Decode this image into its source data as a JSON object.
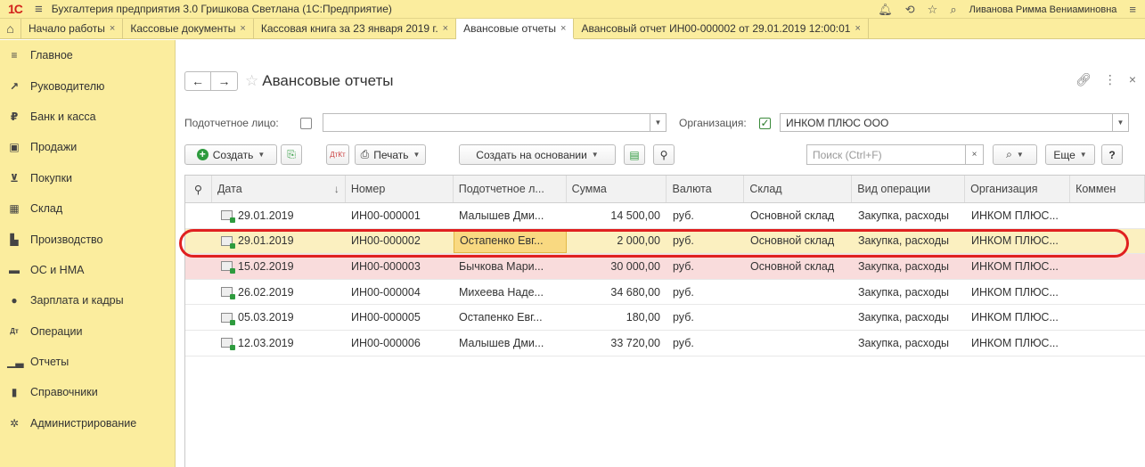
{
  "app": {
    "logo": "1С",
    "title": "Бухгалтерия предприятия 3.0 Гришкова Светлана  (1С:Предприятие)",
    "user": "Ливанова Римма Вениаминовна"
  },
  "tabs": [
    {
      "label": "Начало работы"
    },
    {
      "label": "Кассовые документы"
    },
    {
      "label": "Кассовая книга за 23 января 2019 г."
    },
    {
      "label": "Авансовые отчеты",
      "active": true
    },
    {
      "label": "Авансовый отчет ИН00-000002 от 29.01.2019 12:00:01"
    }
  ],
  "sidebar": {
    "items": [
      {
        "label": "Главное",
        "icon": "menu-icon"
      },
      {
        "label": "Руководителю",
        "icon": "trend-icon"
      },
      {
        "label": "Банк и касса",
        "icon": "coin-icon"
      },
      {
        "label": "Продажи",
        "icon": "bag-icon"
      },
      {
        "label": "Покупки",
        "icon": "cart-icon"
      },
      {
        "label": "Склад",
        "icon": "warehouse-icon"
      },
      {
        "label": "Производство",
        "icon": "factory-icon"
      },
      {
        "label": "ОС и НМА",
        "icon": "truck-icon"
      },
      {
        "label": "Зарплата и кадры",
        "icon": "person-icon"
      },
      {
        "label": "Операции",
        "icon": "dt-kt-icon"
      },
      {
        "label": "Отчеты",
        "icon": "bar-chart-icon"
      },
      {
        "label": "Справочники",
        "icon": "book-icon"
      },
      {
        "label": "Администрирование",
        "icon": "gear-icon"
      }
    ]
  },
  "page": {
    "title": "Авансовые отчеты"
  },
  "filters": {
    "person_label": "Подотчетное лицо:",
    "person_value": "",
    "org_label": "Организация:",
    "org_value": "ИНКОМ ПЛЮС ООО"
  },
  "toolbar": {
    "create": "Создать",
    "print": "Печать",
    "create_based": "Создать на основании",
    "search_placeholder": "Поиск (Ctrl+F)",
    "more": "Еще",
    "help": "?"
  },
  "table": {
    "columns": [
      "Дата",
      "Номер",
      "Подотчетное л...",
      "Сумма",
      "Валюта",
      "Склад",
      "Вид операции",
      "Организация",
      "Коммен"
    ],
    "rows": [
      {
        "date": "29.01.2019",
        "number": "ИН00-000001",
        "person": "Малышев Дми...",
        "sum": "14 500,00",
        "currency": "руб.",
        "warehouse": "Основной склад",
        "operation": "Закупка, расходы",
        "org": "ИНКОМ ПЛЮС..."
      },
      {
        "date": "29.01.2019",
        "number": "ИН00-000002",
        "person": "Остапенко Евг...",
        "sum": "2 000,00",
        "currency": "руб.",
        "warehouse": "Основной склад",
        "operation": "Закупка, расходы",
        "org": "ИНКОМ ПЛЮС..."
      },
      {
        "date": "15.02.2019",
        "number": "ИН00-000003",
        "person": "Бычкова Мари...",
        "sum": "30 000,00",
        "currency": "руб.",
        "warehouse": "Основной склад",
        "operation": "Закупка, расходы",
        "org": "ИНКОМ ПЛЮС..."
      },
      {
        "date": "26.02.2019",
        "number": "ИН00-000004",
        "person": "Михеева Наде...",
        "sum": "34 680,00",
        "currency": "руб.",
        "warehouse": "",
        "operation": "Закупка, расходы",
        "org": "ИНКОМ ПЛЮС..."
      },
      {
        "date": "05.03.2019",
        "number": "ИН00-000005",
        "person": "Остапенко Евг...",
        "sum": "180,00",
        "currency": "руб.",
        "warehouse": "",
        "operation": "Закупка, расходы",
        "org": "ИНКОМ ПЛЮС..."
      },
      {
        "date": "12.03.2019",
        "number": "ИН00-000006",
        "person": "Малышев Дми...",
        "sum": "33 720,00",
        "currency": "руб.",
        "warehouse": "",
        "operation": "Закупка, расходы",
        "org": "ИНКОМ ПЛЮС..."
      }
    ]
  },
  "colors": {
    "panel": "#fbed9e",
    "selected_row": "#fbf0c0",
    "marked_row": "#f9dcdc",
    "highlight": "#e02020"
  }
}
